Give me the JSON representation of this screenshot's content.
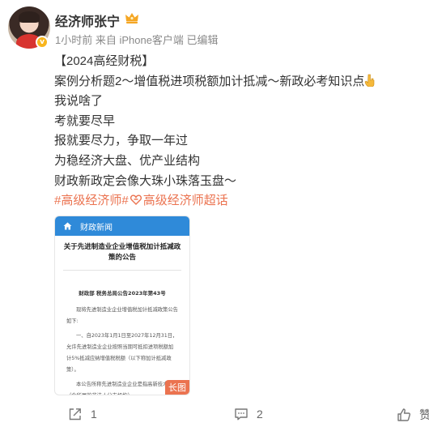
{
  "post": {
    "author": "经济师张宁",
    "meta": "1小时前 来自 iPhone客户端 已编辑",
    "lines": [
      "【2024高经财税】",
      "案例分析题2～增值税进项税额加计抵减～新政必考知识点",
      "我说啥了",
      "考就要尽早",
      "报就要尽力，争取一年过",
      "为稳经济大盘、优产业结构",
      "财政新政定会像大珠小珠落玉盘～"
    ],
    "topic1": "#高级经济师#",
    "topic2": "高级经济师超话"
  },
  "card": {
    "nav_label": "财政新闻",
    "title": "关于先进制造业企业增值税加计抵减政策的公告",
    "subtitle": "财政部 税务总局公告2023年第43号",
    "para1": "现将先进制造业企业增值税加计抵减政策公告如下:",
    "para2": "一、自2023年1月1日至2027年12月31日，允许先进制造业企业按照当期可抵扣进项税额加计5%抵减应纳增值税税额（以下称加计抵减政策）。",
    "para3": "本公告所称先进制造业企业是指高新技术企业（含所属的非法人分支机构）",
    "badge": "长图"
  },
  "actions": {
    "share_count": "1",
    "comment_count": "2",
    "like_label": "赞"
  },
  "colors": {
    "accent": "#eb7350",
    "nav_blue": "#2f8ad9",
    "meta_gray": "#8a8a8a"
  }
}
